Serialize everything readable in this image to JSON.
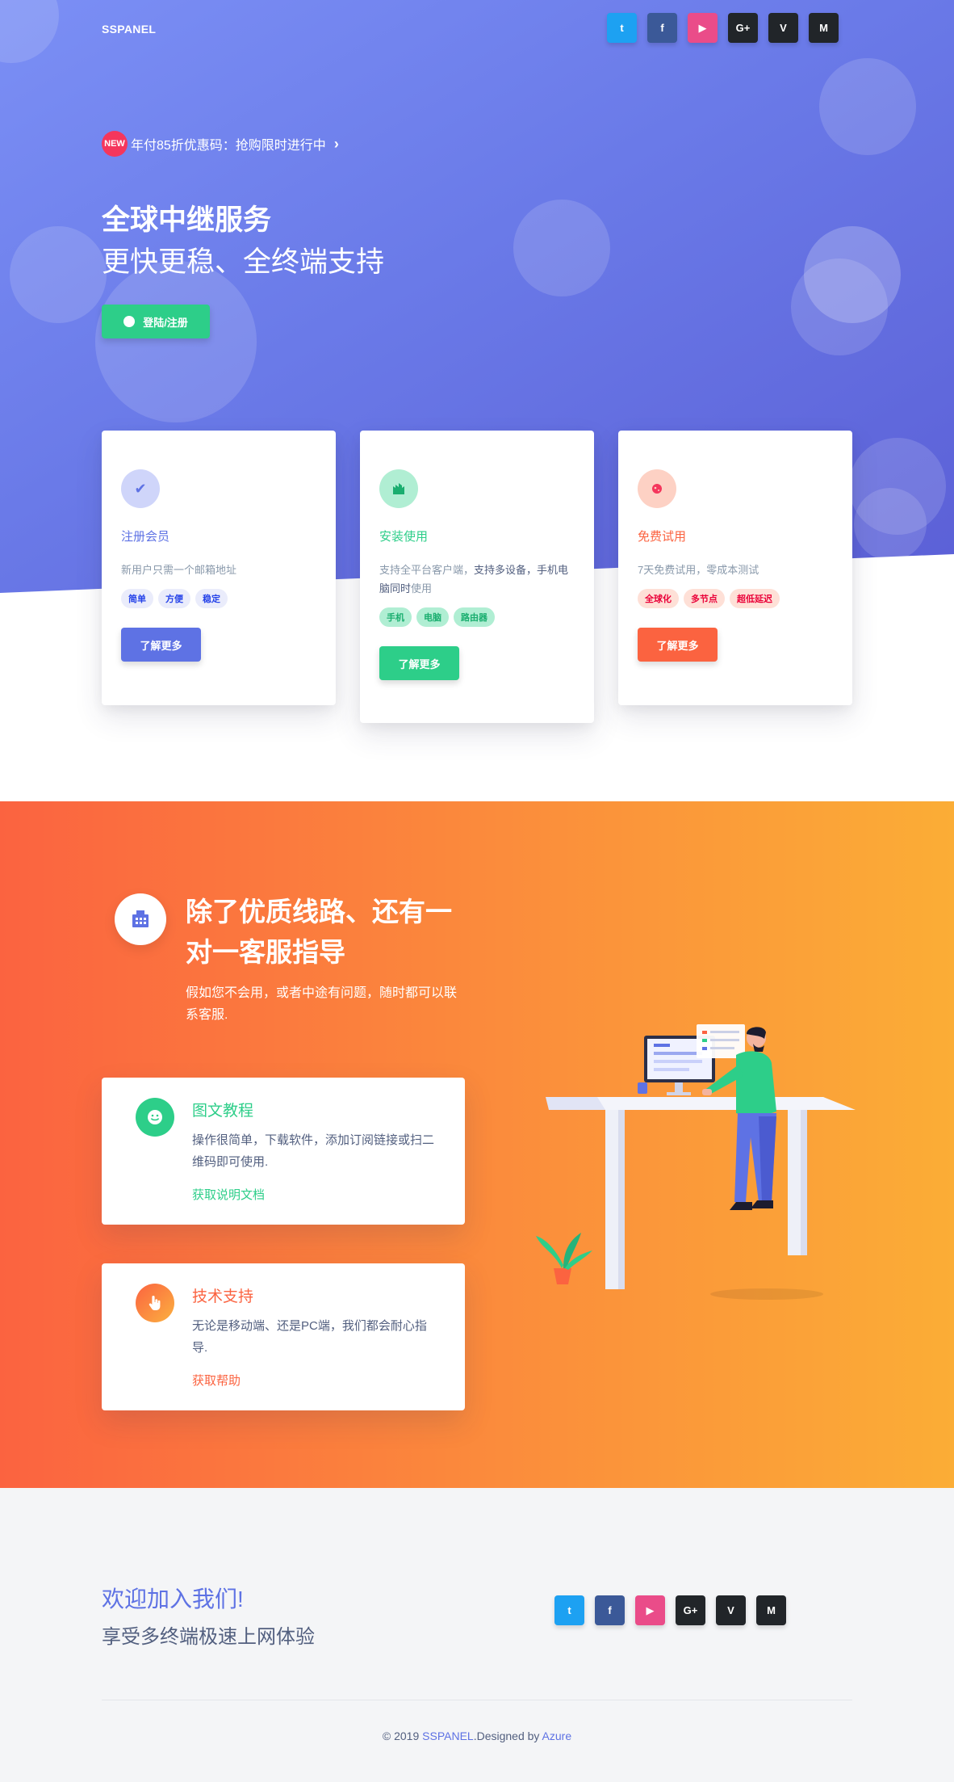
{
  "header": {
    "brand": "SSPANEL",
    "social": [
      {
        "name": "twitter",
        "glyph": "t"
      },
      {
        "name": "facebook",
        "glyph": "f"
      },
      {
        "name": "youtube",
        "glyph": "▶"
      },
      {
        "name": "google-plus",
        "glyph": "G+"
      },
      {
        "name": "vimeo",
        "glyph": "V"
      },
      {
        "name": "medium",
        "glyph": "M"
      }
    ]
  },
  "promo": {
    "badge": "NEW",
    "text": "年付85折优惠码：抢购限时进行中",
    "arrow": "›"
  },
  "hero": {
    "title": "全球中继服务",
    "subtitle": "更快更稳、全终端支持",
    "login_label": "登陆/注册"
  },
  "cards": [
    {
      "title": "注册会员",
      "desc": "新用户只需一个邮箱地址",
      "tags": [
        "简单",
        "方便",
        "稳定"
      ],
      "button": "了解更多",
      "icon": "check-icon",
      "color": "#5e72e4"
    },
    {
      "title": "安装使用",
      "desc_plain": "支持全平台客户端，",
      "desc_strong": "支持多设备，手机电脑同时",
      "desc_tail": "使用",
      "tags": [
        "手机",
        "电脑",
        "路由器"
      ],
      "button": "了解更多",
      "icon": "building-icon",
      "color": "#2dce89"
    },
    {
      "title": "免费试用",
      "desc": "7天免费试用，零成本测试",
      "tags": [
        "全球化",
        "多节点",
        "超低延迟"
      ],
      "button": "了解更多",
      "icon": "planet-icon",
      "color": "#fb6340"
    }
  ],
  "support": {
    "title": "除了优质线路、还有一对一客服指导",
    "desc": "假如您不会用，或者中途有问题，随时都可以联系客服.",
    "items": [
      {
        "title": "图文教程",
        "desc": "操作很简单，下载软件，添加订阅链接或扫二维码即可使用.",
        "link": "获取说明文档",
        "icon": "smile-icon"
      },
      {
        "title": "技术支持",
        "desc": "无论是移动端、还是PC端，我们都会耐心指导.",
        "link": "获取帮助",
        "icon": "hand-icon"
      }
    ]
  },
  "footer": {
    "title": "欢迎加入我们!",
    "subtitle": "享受多终端极速上网体验",
    "copyright_prefix": "© 2019 ",
    "brand_link": "SSPANEL",
    "designed_by": ".Designed by ",
    "author_link": "Azure"
  },
  "colors": {
    "primary": "#5e72e4",
    "success": "#2dce89",
    "warning": "#fb6340"
  }
}
